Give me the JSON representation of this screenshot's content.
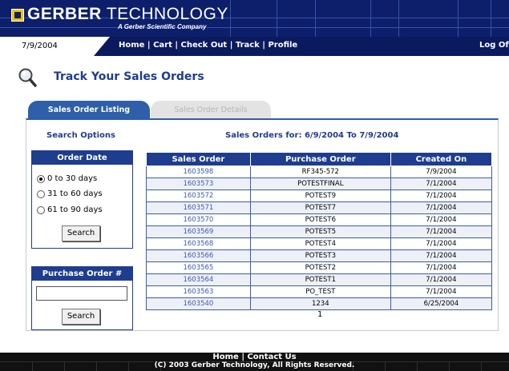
{
  "header": {
    "brand_bold": "GERBER",
    "brand_light": "TECHNOLOGY",
    "tagline": "A Gerber Scientific Company"
  },
  "topbar": {
    "date": "7/9/2004",
    "nav": [
      "Home",
      "Cart",
      "Check Out",
      "Track",
      "Profile"
    ],
    "separator": " | ",
    "logoff": "Log Of"
  },
  "page": {
    "title": "Track Your Sales Orders",
    "icon": "magnifier-icon"
  },
  "tabs": {
    "active": "Sales Order Listing",
    "inactive": "Sales Order Details"
  },
  "search": {
    "heading": "Search Options",
    "order_date": {
      "heading": "Order Date",
      "options": [
        "0 to 30 days",
        "31 to 60 days",
        "61 to 90 days"
      ],
      "selected_index": 0,
      "button": "Search"
    },
    "purchase_order": {
      "heading": "Purchase Order #",
      "value": "",
      "button": "Search"
    }
  },
  "results": {
    "heading": "Sales Orders for: 6/9/2004 To 7/9/2004",
    "columns": [
      "Sales Order",
      "Purchase Order",
      "Created On"
    ],
    "rows": [
      [
        "1603598",
        "RF345-572",
        "7/9/2004"
      ],
      [
        "1603573",
        "POTESTFINAL",
        "7/1/2004"
      ],
      [
        "1603572",
        "POTEST9",
        "7/1/2004"
      ],
      [
        "1603571",
        "POTEST7",
        "7/1/2004"
      ],
      [
        "1603570",
        "POTEST6",
        "7/1/2004"
      ],
      [
        "1603569",
        "POTEST5",
        "7/1/2004"
      ],
      [
        "1603568",
        "POTEST4",
        "7/1/2004"
      ],
      [
        "1603566",
        "POTEST3",
        "7/1/2004"
      ],
      [
        "1603565",
        "POTEST2",
        "7/1/2004"
      ],
      [
        "1603564",
        "POTEST1",
        "7/1/2004"
      ],
      [
        "1603563",
        "PO_TEST",
        "7/1/2004"
      ],
      [
        "1603540",
        "1234",
        "6/25/2004"
      ]
    ],
    "page": "1"
  },
  "footer": {
    "nav": [
      "Home",
      "Contact Us"
    ],
    "separator": " | ",
    "copyright": "(C) 2003 Gerber Technology, All Rights Reserved."
  },
  "colors": {
    "header_navy": "#0d1f6b",
    "accent_blue": "#1f3d8f",
    "tab_blue": "#2e5fa8",
    "logo_yellow": "#f2c200"
  }
}
